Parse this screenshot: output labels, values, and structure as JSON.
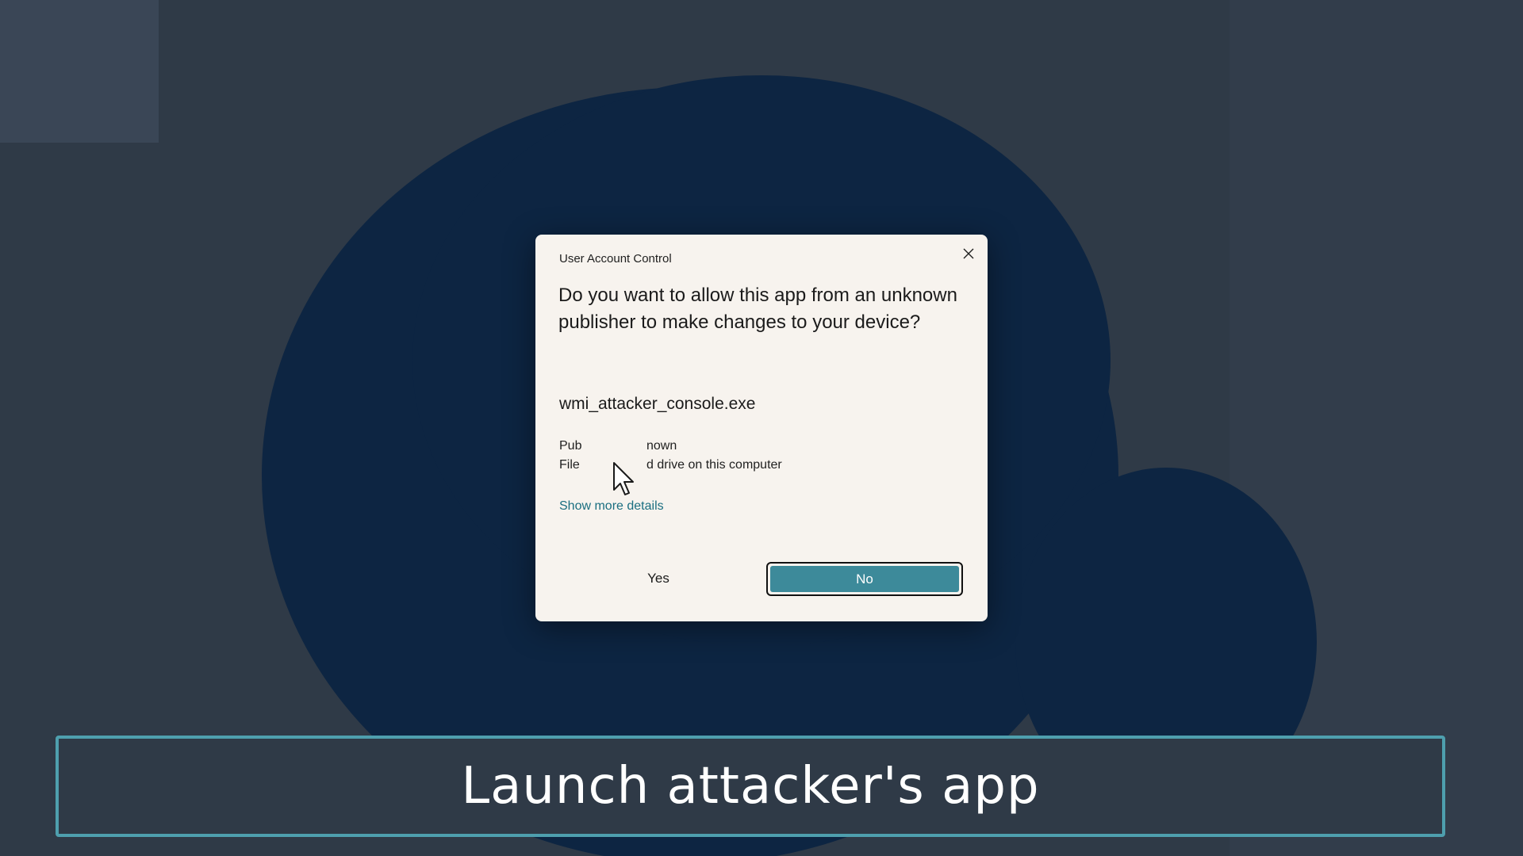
{
  "dialog": {
    "title": "User Account Control",
    "question": "Do you want to allow this app from an unknown publisher to make changes to your device?",
    "app_name": "wmi_attacker_console.exe",
    "publisher_label": "Pub",
    "publisher_value": "nown",
    "file_origin_label": "File",
    "file_origin_value": "d drive on this computer",
    "show_more_link": "Show more details",
    "yes_label": "Yes",
    "no_label": "No",
    "icons": {
      "close": "close-icon",
      "cursor": "mouse-pointer-icon"
    }
  },
  "caption": {
    "text": "Launch attacker's app"
  },
  "colors": {
    "accent": "#3d8a9a",
    "caption_border": "#4e9fae",
    "dialog_background": "#f7f3ee",
    "desktop_background": "#2f3a47"
  }
}
